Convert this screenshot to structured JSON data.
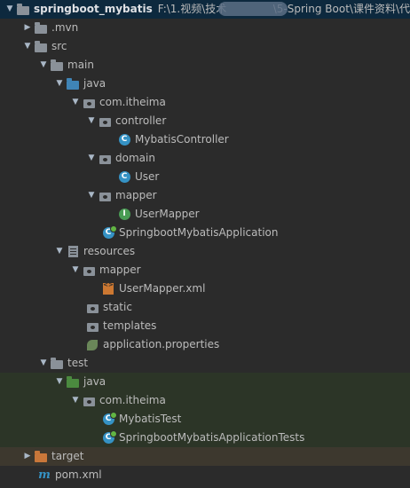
{
  "project": {
    "name": "springboot_mybatis",
    "path": "F:\\1.视频\\技术",
    "path_tail": "\\5-Spring Boot\\课件资料\\代"
  },
  "tree": {
    "mvn": ".mvn",
    "src": "src",
    "main": "main",
    "java": "java",
    "pkg_main": "com.itheima",
    "controller": "controller",
    "mybatis_controller": "MybatisController",
    "domain": "domain",
    "user": "User",
    "mapper_pkg": "mapper",
    "user_mapper": "UserMapper",
    "app": "SpringbootMybatisApplication",
    "resources": "resources",
    "mapper_res": "mapper",
    "user_mapper_xml": "UserMapper.xml",
    "static": "static",
    "templates": "templates",
    "app_props": "application.properties",
    "test": "test",
    "test_java": "java",
    "pkg_test": "com.itheima",
    "mybatis_test": "MybatisTest",
    "app_tests": "SpringbootMybatisApplicationTests",
    "target": "target",
    "pom": "pom.xml"
  },
  "icons": {
    "class_letter": "C",
    "interface_letter": "I",
    "xml_badge": "<>",
    "maven_glyph": "m"
  },
  "colors": {
    "background": "#2b2b2b",
    "selection": "#0d293e",
    "test_root": "#2c3527",
    "excluded": "#3d382e"
  }
}
